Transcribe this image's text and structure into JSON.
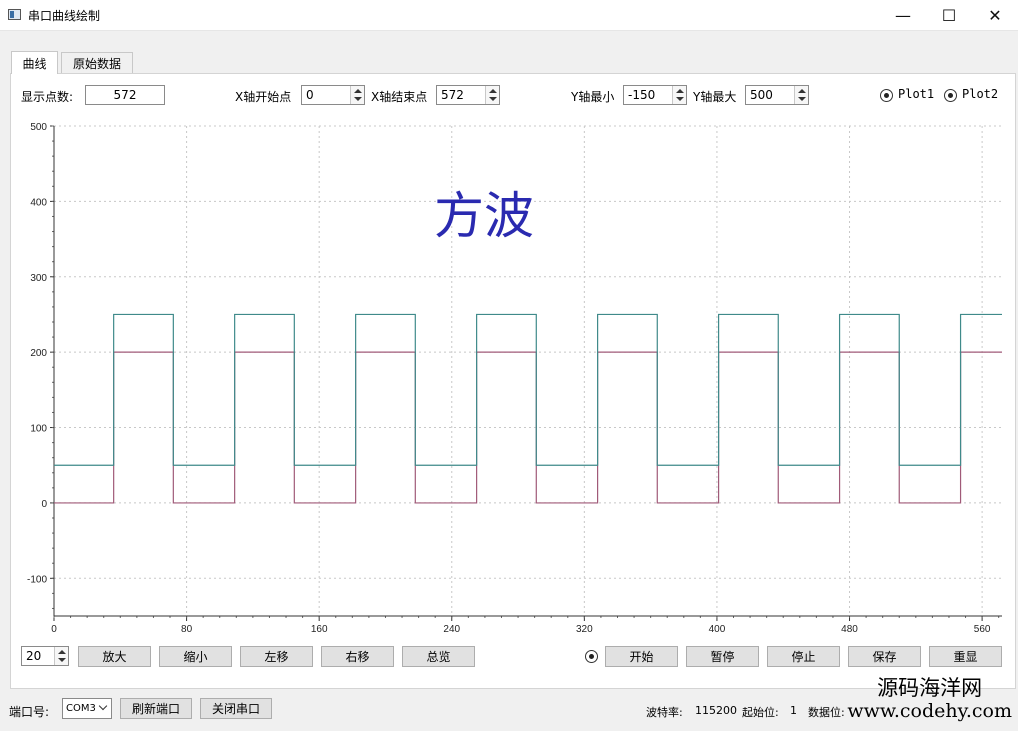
{
  "window": {
    "title": "串口曲线绘制",
    "minimize_glyph": "—",
    "maximize_glyph": "☐",
    "close_glyph": "✕"
  },
  "tabs": [
    {
      "label": "曲线",
      "active": true
    },
    {
      "label": "原始数据",
      "active": false
    }
  ],
  "controls": {
    "display_points_label": "显示点数:",
    "display_points_value": "572",
    "x_start_label": "X轴开始点",
    "x_start_value": "0",
    "x_end_label": "X轴结束点",
    "x_end_value": "572",
    "y_min_label": "Y轴最小",
    "y_min_value": "-150",
    "y_max_label": "Y轴最大",
    "y_max_value": "500",
    "plot1_label": "Plot1",
    "plot2_label": "Plot2"
  },
  "overlay_text": "方波",
  "bottom_controls": {
    "step_value": "20",
    "zoom_in": "放大",
    "zoom_out": "缩小",
    "move_left": "左移",
    "move_right": "右移",
    "overview": "总览",
    "start": "开始",
    "pause": "暂停",
    "stop": "停止",
    "save": "保存",
    "redisplay": "重显"
  },
  "statusbar": {
    "port_label": "端口号:",
    "port_value": "COM3",
    "refresh_port": "刷新端口",
    "close_port": "关闭串口",
    "baud_label": "波特率:",
    "baud_value": "115200",
    "start_bit_label": "起始位:",
    "start_bit_value": "1",
    "data_bits_label": "数据位:"
  },
  "watermark": {
    "line1": "源码海洋网",
    "line2": "www.codehy.com"
  },
  "colors": {
    "plot1": "#a05a78",
    "plot2": "#3f8a8a",
    "overlay": "#2a2ab0",
    "grid": "#c8c8c8"
  },
  "chart_data": {
    "type": "line",
    "xlim": [
      0,
      572
    ],
    "ylim": [
      -150,
      500
    ],
    "x_ticks": [
      0,
      80,
      160,
      240,
      320,
      400,
      480,
      560
    ],
    "y_ticks": [
      500,
      400,
      300,
      200,
      100,
      0,
      -100
    ],
    "grid": true,
    "period": 73,
    "high_start": 36,
    "high_length": 36,
    "series": [
      {
        "name": "Plot1",
        "low": 0,
        "high": 200
      },
      {
        "name": "Plot2",
        "low": 50,
        "high": 250
      }
    ]
  }
}
